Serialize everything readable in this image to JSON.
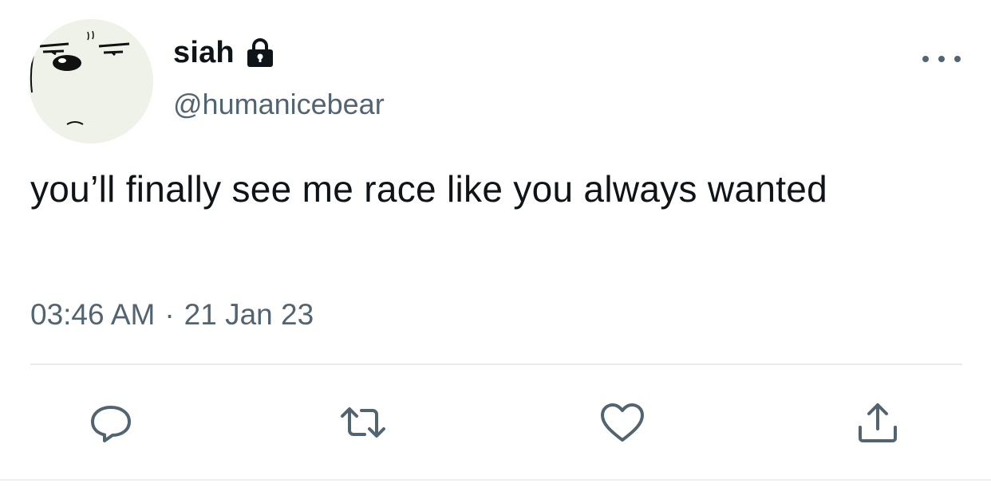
{
  "tweet": {
    "display_name": "siah",
    "handle": "@humanicebear",
    "text": "you’ll finally see me race like you always wanted",
    "time": "03:46 AM",
    "separator": "·",
    "date": "21 Jan 23"
  },
  "icons": {
    "lock": "lock-icon",
    "more": "more-icon",
    "reply": "reply-icon",
    "retweet": "retweet-icon",
    "like": "heart-icon",
    "share": "share-icon"
  },
  "colors": {
    "text_primary": "#0f1419",
    "text_secondary": "#536471",
    "icon": "#536471",
    "avatar_bg": "#eef2e8"
  }
}
